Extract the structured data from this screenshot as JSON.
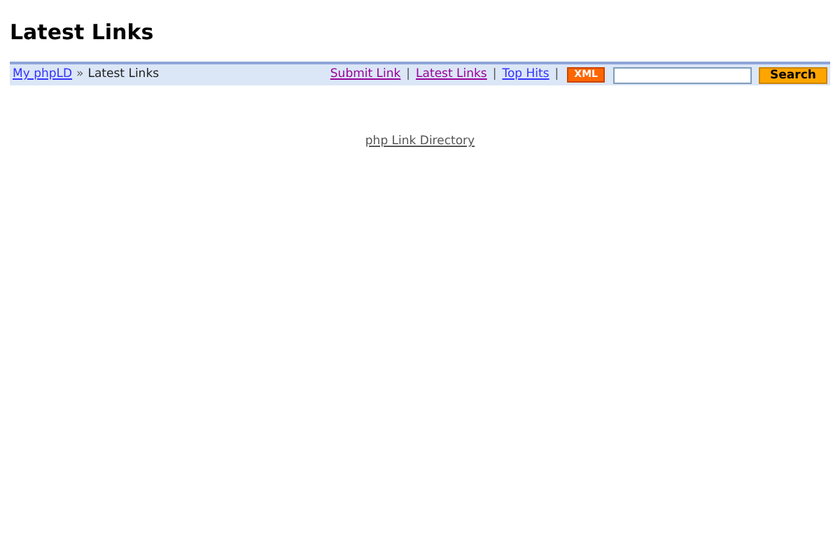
{
  "title": "Latest Links",
  "breadcrumb": {
    "link": "My phpLD",
    "separator": "»",
    "current": "Latest Links"
  },
  "nav_links": [
    {
      "label": "Submit Link",
      "visited": true
    },
    {
      "label": "Latest Links",
      "visited": true
    },
    {
      "label": "Top Hits",
      "visited": false
    }
  ],
  "divider": "|",
  "xml_badge": "XML",
  "search": {
    "button": "Search"
  },
  "footer_link": "php Link Directory"
}
